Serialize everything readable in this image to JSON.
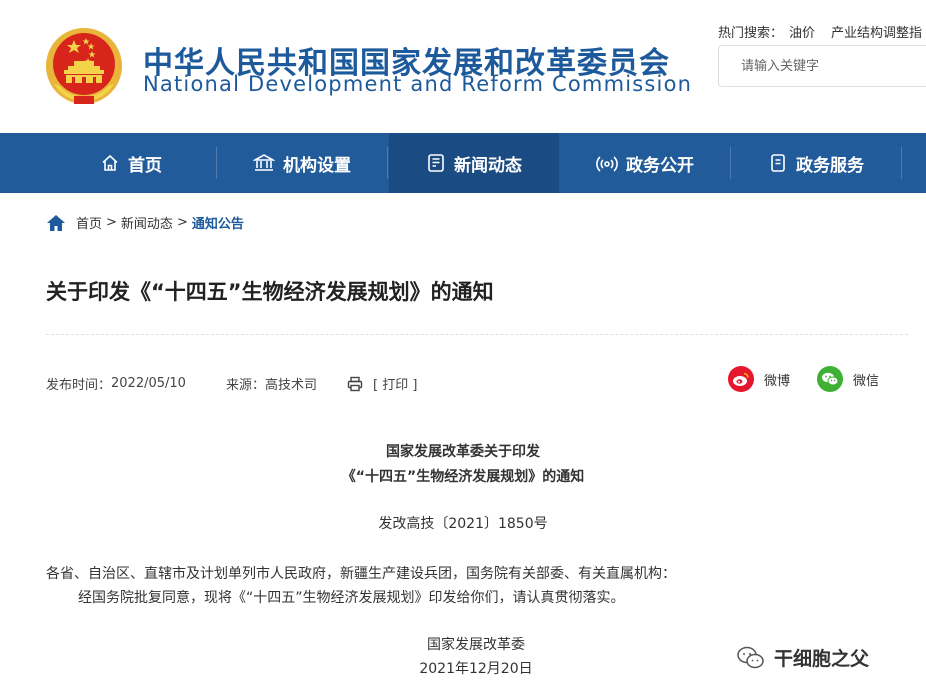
{
  "header": {
    "title_cn": "中华人民共和国国家发展和改革委员会",
    "title_en": "National Development and Reform Commission",
    "hot_search_label": "热门搜索：",
    "hot_search_links": [
      "油价",
      "产业结构调整指"
    ],
    "search_placeholder": "请输入关键字"
  },
  "nav": {
    "items": [
      {
        "label": "首页",
        "icon": "home-icon"
      },
      {
        "label": "机构设置",
        "icon": "institution-icon"
      },
      {
        "label": "新闻动态",
        "icon": "news-icon"
      },
      {
        "label": "政务公开",
        "icon": "broadcast-icon"
      },
      {
        "label": "政务服务",
        "icon": "service-icon"
      }
    ],
    "active_index": 2
  },
  "breadcrumb": {
    "items": [
      "首页",
      "新闻动态",
      "通知公告"
    ],
    "separator": ">"
  },
  "article": {
    "title": "关于印发《“十四五”生物经济发展规划》的通知",
    "publish_label": "发布时间：",
    "publish_date": "2022/05/10",
    "source_label": "来源：",
    "source": "高技术司",
    "print_label": "[ 打印 ]",
    "share": [
      {
        "label": "微博",
        "icon": "weibo-icon",
        "color": "#e6162d"
      },
      {
        "label": "微信",
        "icon": "wechat-icon",
        "color": "#3eb135"
      }
    ],
    "doc_heading_line1": "国家发展改革委关于印发",
    "doc_heading_line2": "《“十四五”生物经济发展规划》的通知",
    "doc_number": "发改高技〔2021〕1850号",
    "addressee": "各省、自治区、直辖市及计划单列市人民政府，新疆生产建设兵团，国务院有关部委、有关直属机构：",
    "body": "经国务院批复同意，现将《“十四五”生物经济发展规划》印发给你们，请认真贯彻落实。",
    "signer": "国家发展改革委",
    "sign_date": "2021年12月20日"
  },
  "watermark": {
    "text": "干细胞之父"
  },
  "colors": {
    "brand_blue": "#215b9a",
    "nav_active": "#1a4b82",
    "title_blue": "#1d5a9c"
  }
}
